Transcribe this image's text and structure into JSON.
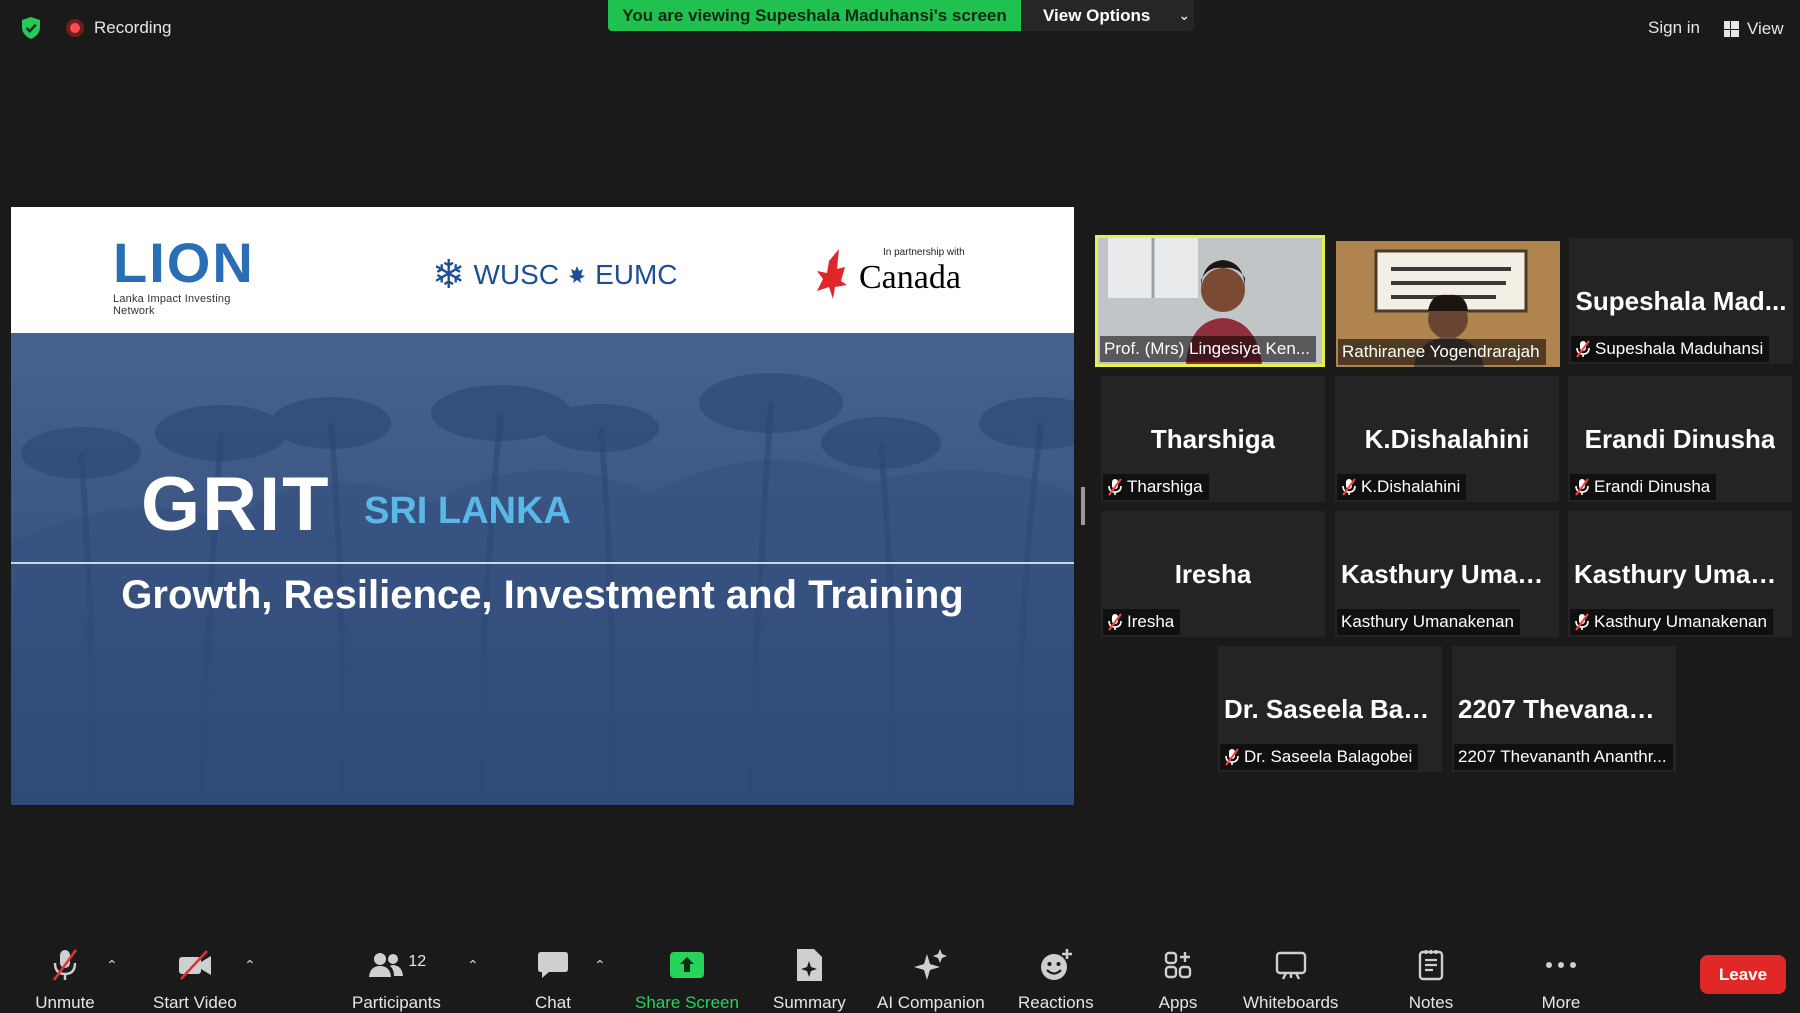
{
  "top": {
    "recording": "Recording",
    "viewing_banner": "You are viewing Supeshala Maduhansi's screen",
    "view_options": "View Options",
    "sign_in": "Sign in",
    "view": "View"
  },
  "slide": {
    "lion_word": "LION",
    "lion_sub": "Lanka Impact Investing Network",
    "wusc": "WUSC",
    "eumc": "EUMC",
    "partnership": "In partnership with",
    "canada": "Canada",
    "grit": "GRIT",
    "country": "SRI LANKA",
    "tagline": "Growth, Resilience, Investment and Training"
  },
  "participants": [
    {
      "display": "",
      "label": "Prof. (Mrs) Lingesiya Ken...",
      "muted": false,
      "video": true
    },
    {
      "display": "",
      "label": "Rathiranee Yogendrarajah",
      "muted": false,
      "video": true
    },
    {
      "display": "Supeshala  Mad...",
      "label": "Supeshala Maduhansi",
      "muted": true
    },
    {
      "display": "Tharshiga",
      "label": "Tharshiga",
      "muted": true
    },
    {
      "display": "K.Dishalahini",
      "label": "K.Dishalahini",
      "muted": true
    },
    {
      "display": "Erandi Dinusha",
      "label": "Erandi Dinusha",
      "muted": true
    },
    {
      "display": "Iresha",
      "label": "Iresha",
      "muted": true
    },
    {
      "display": "Kasthury  Uman...",
      "label": "Kasthury Umanakenan",
      "muted": false
    },
    {
      "display": "Kasthury  Uman...",
      "label": "Kasthury Umanakenan",
      "muted": true
    },
    {
      "display": "Dr. Saseela Bala...",
      "label": "Dr. Saseela Balagobei",
      "muted": true
    },
    {
      "display": "2207  Thevanant...",
      "label": "2207 Thevananth Ananthr...",
      "muted": false
    }
  ],
  "toolbar": {
    "unmute": "Unmute",
    "start_video": "Start Video",
    "participants": "Participants",
    "participants_count": "12",
    "chat": "Chat",
    "share_screen": "Share Screen",
    "summary": "Summary",
    "ai_companion": "AI Companion",
    "reactions": "Reactions",
    "apps": "Apps",
    "whiteboards": "Whiteboards",
    "notes": "Notes",
    "more": "More",
    "leave": "Leave"
  },
  "colors": {
    "share_green": "#21c14f",
    "leave_red": "#e02828",
    "active_speaker": "#e8f04a",
    "slide_blue": "#3d5785",
    "sri_lanka_text": "#59b8e8"
  }
}
